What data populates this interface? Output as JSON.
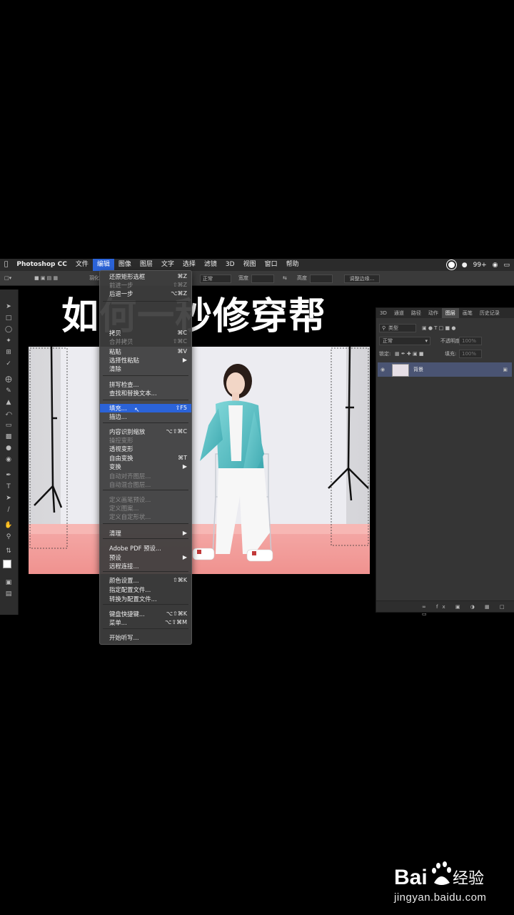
{
  "menubar": {
    "apple_icon": "apple-icon",
    "items": [
      "Photoshop CC",
      "文件",
      "编辑",
      "图像",
      "图层",
      "文字",
      "选择",
      "滤镜",
      "3D",
      "视图",
      "窗口",
      "帮助"
    ],
    "active_index": 2,
    "notification_badge": "99+"
  },
  "optionsbar": {
    "feather_label": "羽化",
    "style_value": "正常",
    "width_label": "宽度",
    "height_label": "高度",
    "refine_edge_label": "调整边缘..."
  },
  "overlay": {
    "title": "如何一秒修穿帮"
  },
  "edit_menu": {
    "rows": [
      {
        "label": "还原矩形选框",
        "shortcut": "⌘Z",
        "disabled": false
      },
      {
        "label": "前进一步",
        "shortcut": "⇧⌘Z",
        "disabled": true
      },
      {
        "label": "后退一步",
        "shortcut": "⌥⌘Z",
        "disabled": false
      },
      {
        "label": "拷贝",
        "shortcut": "⌘C",
        "disabled": false
      },
      {
        "label": "合并拷贝",
        "shortcut": "⇧⌘C",
        "disabled": true
      },
      {
        "label": "粘贴",
        "shortcut": "⌘V",
        "disabled": false
      },
      {
        "label": "选择性粘贴",
        "shortcut": "▶",
        "disabled": false
      },
      {
        "label": "清除",
        "shortcut": "",
        "disabled": false
      },
      {
        "label": "拼写检查...",
        "shortcut": "",
        "disabled": false
      },
      {
        "label": "查找和替换文本...",
        "shortcut": "",
        "disabled": false
      },
      {
        "label": "填充...",
        "shortcut": "⇧F5",
        "disabled": false,
        "highlighted": true
      },
      {
        "label": "描边...",
        "shortcut": "",
        "disabled": false
      },
      {
        "label": "内容识别缩放",
        "shortcut": "⌥⇧⌘C",
        "disabled": false
      },
      {
        "label": "操控变形",
        "shortcut": "",
        "disabled": true
      },
      {
        "label": "透视变形",
        "shortcut": "",
        "disabled": false
      },
      {
        "label": "自由变换",
        "shortcut": "⌘T",
        "disabled": false
      },
      {
        "label": "变换",
        "shortcut": "▶",
        "disabled": false
      },
      {
        "label": "自动对齐图层...",
        "shortcut": "",
        "disabled": true
      },
      {
        "label": "自动混合图层...",
        "shortcut": "",
        "disabled": true
      },
      {
        "label": "定义画笔预设...",
        "shortcut": "",
        "disabled": true
      },
      {
        "label": "定义图案...",
        "shortcut": "",
        "disabled": true
      },
      {
        "label": "定义自定形状...",
        "shortcut": "",
        "disabled": true
      },
      {
        "label": "清理",
        "shortcut": "▶",
        "disabled": false
      },
      {
        "label": "Adobe PDF 预设...",
        "shortcut": "",
        "disabled": false
      },
      {
        "label": "预设",
        "shortcut": "▶",
        "disabled": false
      },
      {
        "label": "远程连接...",
        "shortcut": "",
        "disabled": false
      },
      {
        "label": "颜色设置...",
        "shortcut": "⇧⌘K",
        "disabled": false
      },
      {
        "label": "指定配置文件...",
        "shortcut": "",
        "disabled": false
      },
      {
        "label": "转换为配置文件...",
        "shortcut": "",
        "disabled": false
      },
      {
        "label": "键盘快捷键...",
        "shortcut": "⌥⇧⌘K",
        "disabled": false
      },
      {
        "label": "菜单...",
        "shortcut": "⌥⇧⌘M",
        "disabled": false
      },
      {
        "label": "开始听写...",
        "shortcut": "",
        "disabled": false
      }
    ]
  },
  "layers_panel": {
    "tabs": [
      "3D",
      "通道",
      "路径",
      "动作",
      "图层",
      "画笔",
      "历史记录"
    ],
    "active_tab": 4,
    "filter_label": "类型",
    "blend_mode": "正常",
    "opacity_label": "不透明度:",
    "opacity_value": "100%",
    "lock_label": "锁定:",
    "fill_label": "填充:",
    "fill_value": "100%",
    "layer_name": "背景"
  },
  "watermark": {
    "logo_text": "Bai经验",
    "url": "jingyan.baidu.com"
  }
}
